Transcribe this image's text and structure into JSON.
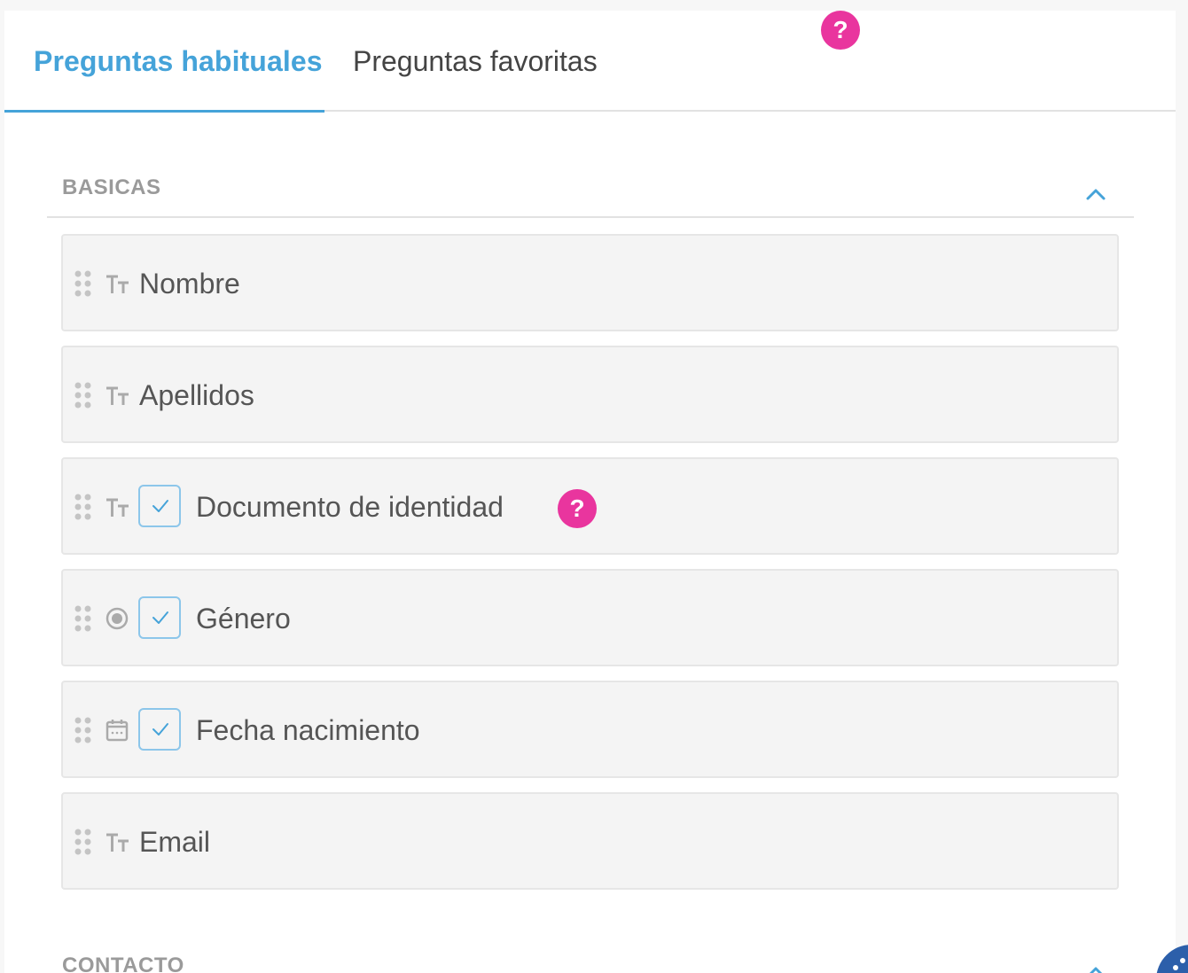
{
  "tabs": [
    {
      "label": "Preguntas habituales",
      "active": true
    },
    {
      "label": "Preguntas favoritas",
      "active": false
    }
  ],
  "help_badge": "?",
  "sections": {
    "basicas": {
      "title": "BASICAS",
      "expanded": true
    },
    "contacto": {
      "title": "CONTACTO",
      "expanded": true
    }
  },
  "questions": [
    {
      "label": "Nombre",
      "type_icon": "text-type-icon",
      "checked": null
    },
    {
      "label": "Apellidos",
      "type_icon": "text-type-icon",
      "checked": null
    },
    {
      "label": "Documento de identidad",
      "type_icon": "text-type-icon",
      "checked": true
    },
    {
      "label": "Género",
      "type_icon": "radio-type-icon",
      "checked": true
    },
    {
      "label": "Fecha nacimiento",
      "type_icon": "calendar-type-icon",
      "checked": true
    },
    {
      "label": "Email",
      "type_icon": "text-type-icon",
      "checked": null
    }
  ],
  "colors": {
    "accent": "#45a3d9",
    "help": "#e9359e",
    "card_bg": "#f4f4f4",
    "section_title": "#9a9a9a",
    "fab": "#2c5faa"
  }
}
